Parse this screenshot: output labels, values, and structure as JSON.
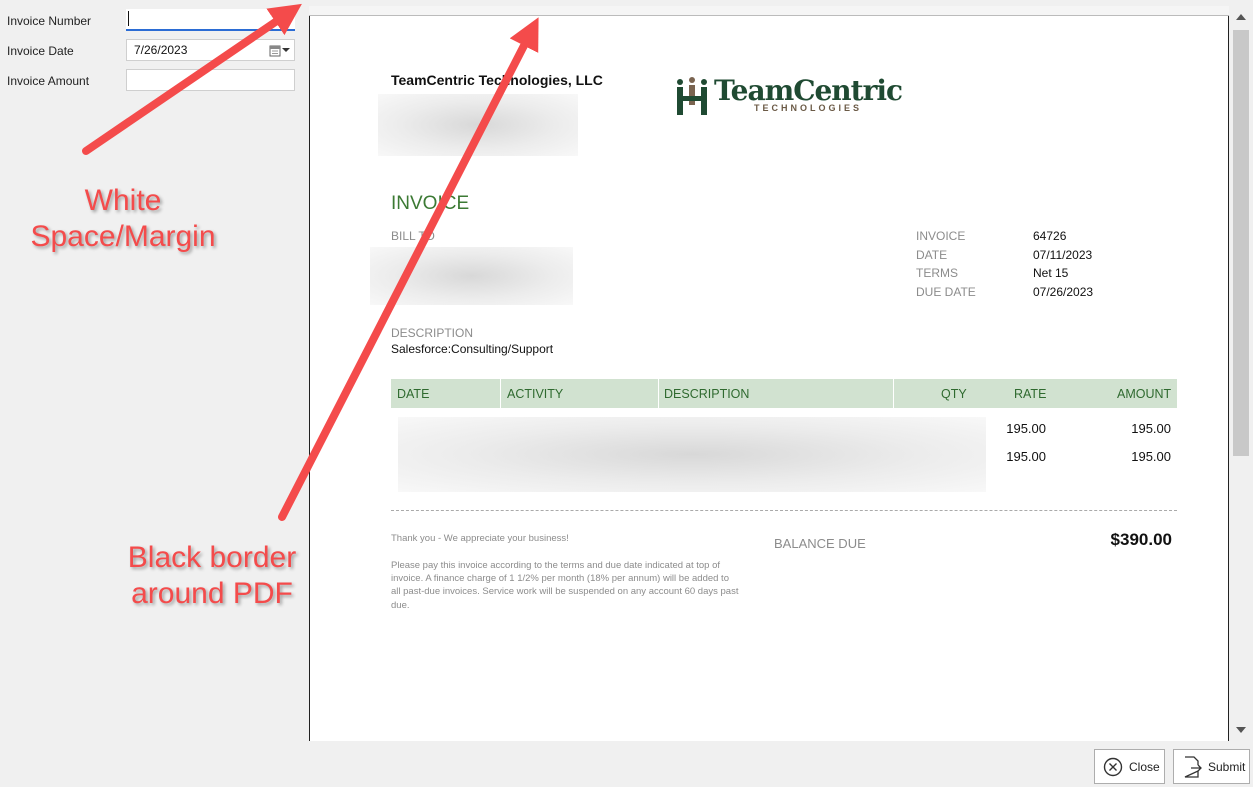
{
  "form": {
    "invoice_number_label": "Invoice Number",
    "invoice_number_value": "",
    "invoice_date_label": "Invoice Date",
    "invoice_date_value": "7/26/2023",
    "invoice_amount_label": "Invoice Amount",
    "invoice_amount_value": ""
  },
  "invoice": {
    "company_name": "TeamCentric Technologies, LLC",
    "logo_name": "TeamCentric",
    "logo_sub": "TECHNOLOGIES",
    "title": "INVOICE",
    "bill_to_label": "BILL TO",
    "meta": [
      {
        "key": "INVOICE",
        "value": "64726"
      },
      {
        "key": "DATE",
        "value": "07/11/2023"
      },
      {
        "key": "TERMS",
        "value": "Net 15"
      },
      {
        "key": "DUE DATE",
        "value": "07/26/2023"
      }
    ],
    "description_label": "DESCRIPTION",
    "description_value": "Salesforce:Consulting/Support",
    "columns": [
      "DATE",
      "ACTIVITY",
      "DESCRIPTION",
      "QTY",
      "RATE",
      "AMOUNT"
    ],
    "rows": [
      {
        "rate": "195.00",
        "amount": "195.00"
      },
      {
        "rate": "195.00",
        "amount": "195.00"
      }
    ],
    "thanks": "Thank you - We appreciate your business!",
    "terms_text": "Please pay this invoice according to the terms and due date indicated at top of invoice. A finance charge of 1 1/2% per month (18% per annum) will be added to all past-due invoices. Service work will be suspended on any account 60 days past due.",
    "balance_due_label": "BALANCE DUE",
    "balance_due": "$390.00"
  },
  "annotations": {
    "margin_line1": "White",
    "margin_line2": "Space/Margin",
    "border_line1": "Black border",
    "border_line2": "around PDF"
  },
  "buttons": {
    "close": "Close",
    "submit": "Submit"
  },
  "colors": {
    "accent_green": "#3c7a34",
    "table_header": "#d1e2d0",
    "annotation_red": "#f44b4b",
    "focus_blue": "#2b6cd4"
  }
}
